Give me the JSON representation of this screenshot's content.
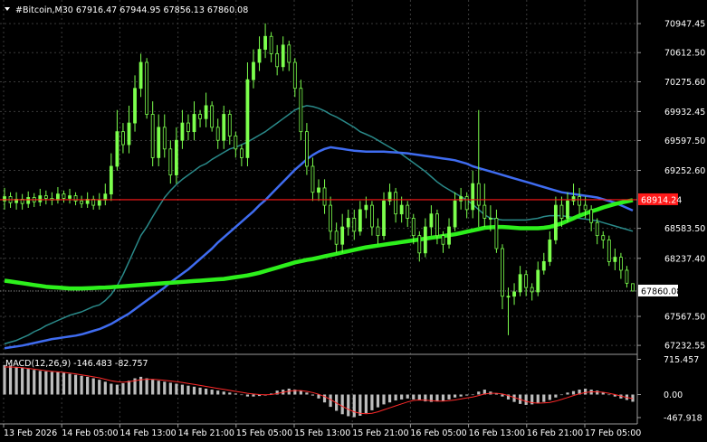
{
  "window": {
    "symbol_line": "#Bitcoin,M30  67916.47 67944.95 67856.13 67860.08"
  },
  "colors": {
    "background": "#000000",
    "grid": "#3a3a3a",
    "axis": "#9a9a9a",
    "text": "#ffffff",
    "candle": "#7cff4d",
    "ma_fast": "#2a8a8a",
    "ma_mid": "#3f6cf0",
    "ma_slow": "#2df01c",
    "hline": "#ff1a1a",
    "price_tag_bg": "#ffffff",
    "price_tag_text": "#000000",
    "hline_tag_text": "#ffffff",
    "macd_hist": "#bdbdbd",
    "macd_signal": "#ff2a2a"
  },
  "chart_data": {
    "type": "candlestick",
    "title": "#Bitcoin,M30  67916.47 67944.95 67856.13 67860.08",
    "ylim": [
      67150,
      71220
    ],
    "y_ticks": [
      "70947.45",
      "70612.50",
      "70275.60",
      "69932.45",
      "69597.50",
      "69252.60",
      "68914.24",
      "68583.50",
      "68237.40",
      "67860.08",
      "67567.50",
      "67232.55"
    ],
    "x_ticks": [
      "13 Feb 2026",
      "14 Feb 05:00",
      "14 Feb 13:00",
      "14 Feb 21:00",
      "15 Feb 05:00",
      "15 Feb 13:00",
      "15 Feb 21:00",
      "16 Feb 05:00",
      "16 Feb 13:00",
      "16 Feb 21:00",
      "17 Feb 05:00"
    ],
    "current_price": "67860.08",
    "horizontal_line": {
      "value": "68914.24"
    },
    "close": [
      68950,
      68880,
      68920,
      68870,
      68940,
      68890,
      68960,
      68930,
      68910,
      68980,
      68930,
      68960,
      68900,
      68870,
      68920,
      68850,
      68910,
      68980,
      69300,
      69700,
      69550,
      69800,
      70200,
      70500,
      69900,
      69400,
      69750,
      69500,
      69200,
      69600,
      69800,
      69700,
      69900,
      69850,
      70000,
      69750,
      69600,
      69900,
      69650,
      69500,
      69400,
      70300,
      70500,
      70650,
      70800,
      70600,
      70450,
      70700,
      70500,
      70200,
      69700,
      69300,
      69000,
      69050,
      68850,
      68550,
      68400,
      68600,
      68700,
      68550,
      68800,
      68850,
      68600,
      68500,
      68900,
      69000,
      68750,
      68850,
      68700,
      68500,
      68300,
      68600,
      68750,
      68500,
      68400,
      68600,
      68900,
      68950,
      68800,
      69100,
      68850,
      68700,
      68700,
      68350,
      67800,
      67800,
      67850,
      68050,
      67900,
      67850,
      68100,
      68200,
      68450,
      68850,
      68700,
      68900,
      68950,
      68850,
      68800,
      68650,
      68500,
      68450,
      68200,
      68250,
      68100,
      67950,
      67860
    ],
    "open": [
      68900,
      68950,
      68880,
      68920,
      68870,
      68940,
      68890,
      68960,
      68930,
      68910,
      68980,
      68930,
      68960,
      68900,
      68870,
      68920,
      68850,
      68910,
      68980,
      69300,
      69700,
      69550,
      69800,
      70200,
      70500,
      69900,
      69400,
      69750,
      69500,
      69200,
      69600,
      69800,
      69700,
      69900,
      69850,
      70000,
      69750,
      69600,
      69900,
      69650,
      69500,
      69400,
      70300,
      70500,
      70650,
      70800,
      70600,
      70450,
      70700,
      70500,
      70200,
      69700,
      69300,
      69000,
      69050,
      68850,
      68550,
      68400,
      68600,
      68700,
      68550,
      68800,
      68850,
      68600,
      68500,
      68900,
      69000,
      68750,
      68850,
      68700,
      68500,
      68300,
      68600,
      68750,
      68500,
      68400,
      68600,
      68900,
      68950,
      68800,
      69100,
      68850,
      68700,
      68700,
      68350,
      67800,
      67800,
      67850,
      68050,
      67900,
      67850,
      68100,
      68200,
      68450,
      68850,
      68700,
      68900,
      68950,
      68850,
      68800,
      68650,
      68500,
      68450,
      68200,
      68250,
      68100,
      67944.95
    ],
    "high": [
      69050,
      69000,
      69000,
      68980,
      69010,
      68990,
      69040,
      69020,
      69000,
      69060,
      69020,
      69040,
      69000,
      68960,
      69000,
      68960,
      68990,
      69100,
      69450,
      69950,
      69800,
      70000,
      70350,
      70600,
      70550,
      70050,
      69900,
      69900,
      69600,
      69750,
      69950,
      69900,
      70050,
      69950,
      70150,
      70050,
      69850,
      70000,
      69950,
      69700,
      69550,
      70500,
      70650,
      70800,
      70950,
      70850,
      70700,
      70800,
      70750,
      70550,
      70300,
      69800,
      69400,
      69150,
      69150,
      68950,
      68650,
      68750,
      68800,
      68800,
      68900,
      68950,
      68900,
      68700,
      69000,
      69100,
      69050,
      68950,
      68900,
      68750,
      68550,
      68700,
      68850,
      68800,
      68550,
      68700,
      69000,
      69050,
      69000,
      69250,
      69950,
      69100,
      68850,
      68800,
      68400,
      67900,
      67950,
      68150,
      68100,
      67950,
      68200,
      68300,
      68550,
      68950,
      68950,
      69000,
      69100,
      69050,
      68950,
      68850,
      68700,
      68550,
      68500,
      68350,
      68300,
      68150,
      67944.95
    ],
    "low": [
      68800,
      68820,
      68800,
      68800,
      68820,
      68830,
      68840,
      68860,
      68850,
      68870,
      68880,
      68870,
      68850,
      68820,
      68820,
      68800,
      68800,
      68850,
      68900,
      69250,
      69450,
      69450,
      69700,
      70100,
      69850,
      69300,
      69300,
      69400,
      69100,
      69100,
      69500,
      69600,
      69600,
      69750,
      69750,
      69700,
      69500,
      69500,
      69550,
      69400,
      69300,
      69300,
      70200,
      70400,
      70550,
      70500,
      70350,
      70400,
      70400,
      70100,
      69600,
      69200,
      68900,
      68900,
      68750,
      68450,
      68300,
      68300,
      68500,
      68450,
      68500,
      68700,
      68500,
      68400,
      68450,
      68850,
      68650,
      68650,
      68600,
      68400,
      68200,
      68250,
      68500,
      68400,
      68300,
      68350,
      68550,
      68800,
      68700,
      68700,
      68600,
      68600,
      68550,
      68300,
      67650,
      67350,
      67700,
      67800,
      67800,
      67750,
      67800,
      68050,
      68150,
      68400,
      68600,
      68650,
      68850,
      68750,
      68700,
      68550,
      68400,
      68350,
      68150,
      68100,
      68000,
      67900,
      67856.13
    ],
    "series": [
      {
        "values": [
          67250,
          67270,
          67290,
          67320,
          67350,
          67390,
          67420,
          67460,
          67490,
          67520,
          67550,
          67580,
          67600,
          67620,
          67650,
          67680,
          67700,
          67750,
          67820,
          67920,
          68050,
          68200,
          68350,
          68500,
          68600,
          68720,
          68830,
          68940,
          69020,
          69090,
          69150,
          69200,
          69250,
          69300,
          69330,
          69380,
          69420,
          69460,
          69500,
          69520,
          69550,
          69580,
          69620,
          69660,
          69700,
          69750,
          69800,
          69850,
          69900,
          69950,
          69980,
          70000,
          69990,
          69970,
          69940,
          69900,
          69870,
          69830,
          69790,
          69750,
          69700,
          69670,
          69640,
          69600,
          69560,
          69520,
          69480,
          69440,
          69390,
          69340,
          69290,
          69240,
          69180,
          69120,
          69070,
          69030,
          68990,
          68950,
          68910,
          68860,
          68800,
          68740,
          68700,
          68690,
          68680,
          68680,
          68680,
          68680,
          68680,
          68690,
          68700,
          68720,
          68730,
          68730,
          68730,
          68720,
          68710,
          68700,
          68690,
          68680,
          68670,
          68650,
          68630,
          68610,
          68590,
          68570,
          68550
        ]
      },
      {
        "values": [
          67200,
          67210,
          67220,
          67230,
          67245,
          67260,
          67275,
          67290,
          67305,
          67315,
          67325,
          67335,
          67345,
          67360,
          67380,
          67400,
          67420,
          67450,
          67480,
          67520,
          67560,
          67600,
          67650,
          67700,
          67750,
          67800,
          67850,
          67900,
          67960,
          68010,
          68060,
          68110,
          68170,
          68230,
          68290,
          68350,
          68420,
          68480,
          68540,
          68600,
          68660,
          68720,
          68780,
          68850,
          68910,
          68980,
          69050,
          69120,
          69190,
          69260,
          69320,
          69380,
          69430,
          69470,
          69500,
          69520,
          69510,
          69500,
          69490,
          69480,
          69475,
          69470,
          69470,
          69470,
          69470,
          69465,
          69460,
          69455,
          69450,
          69440,
          69430,
          69420,
          69410,
          69400,
          69390,
          69380,
          69370,
          69350,
          69330,
          69300,
          69280,
          69260,
          69240,
          69220,
          69200,
          69180,
          69160,
          69140,
          69120,
          69100,
          69080,
          69060,
          69040,
          69020,
          69000,
          68990,
          68980,
          68970,
          68960,
          68950,
          68940,
          68920,
          68900,
          68880,
          68850,
          68820,
          68790
        ]
      },
      {
        "values": [
          67980,
          67970,
          67960,
          67950,
          67940,
          67930,
          67920,
          67910,
          67905,
          67900,
          67895,
          67890,
          67890,
          67890,
          67892,
          67895,
          67898,
          67900,
          67905,
          67910,
          67915,
          67920,
          67925,
          67930,
          67935,
          67940,
          67945,
          67950,
          67955,
          67960,
          67965,
          67970,
          67975,
          67980,
          67985,
          67990,
          67995,
          68000,
          68010,
          68020,
          68030,
          68040,
          68055,
          68070,
          68090,
          68110,
          68130,
          68150,
          68170,
          68190,
          68205,
          68220,
          68230,
          68245,
          68260,
          68275,
          68290,
          68305,
          68320,
          68335,
          68350,
          68365,
          68375,
          68385,
          68395,
          68405,
          68415,
          68425,
          68435,
          68445,
          68455,
          68465,
          68475,
          68485,
          68495,
          68505,
          68515,
          68530,
          68545,
          68560,
          68575,
          68590,
          68595,
          68600,
          68600,
          68595,
          68590,
          68585,
          68585,
          68585,
          68585,
          68590,
          68600,
          68620,
          68640,
          68670,
          68700,
          68730,
          68755,
          68780,
          68800,
          68825,
          68845,
          68865,
          68880,
          68895,
          68910
        ]
      }
    ],
    "macd": {
      "label": "MACD(12,26,9) -146.483 -82.757",
      "ylim": [
        -560,
        780
      ],
      "y_ticks": [
        "715.457",
        "0.00",
        "-467.918"
      ],
      "histogram": [
        600,
        590,
        560,
        540,
        520,
        500,
        480,
        470,
        460,
        455,
        440,
        420,
        400,
        380,
        360,
        330,
        300,
        260,
        220,
        200,
        230,
        280,
        330,
        360,
        330,
        300,
        280,
        260,
        240,
        220,
        200,
        180,
        160,
        140,
        120,
        100,
        80,
        60,
        40,
        20,
        0,
        -40,
        -40,
        -30,
        -20,
        20,
        80,
        100,
        120,
        100,
        80,
        40,
        -20,
        -80,
        -160,
        -250,
        -330,
        -400,
        -440,
        -460,
        -430,
        -380,
        -320,
        -260,
        -200,
        -160,
        -120,
        -100,
        -80,
        -100,
        -120,
        -140,
        -150,
        -140,
        -130,
        -100,
        -60,
        -40,
        -20,
        0,
        60,
        100,
        60,
        20,
        -40,
        -100,
        -150,
        -190,
        -210,
        -200,
        -180,
        -150,
        -110,
        -60,
        0,
        40,
        70,
        100,
        120,
        100,
        80,
        40,
        0,
        -40,
        -80,
        -110,
        -146.483
      ],
      "signal": [
        560,
        560,
        555,
        545,
        530,
        515,
        500,
        485,
        470,
        460,
        450,
        435,
        420,
        400,
        380,
        360,
        340,
        310,
        280,
        260,
        250,
        260,
        280,
        300,
        310,
        310,
        300,
        290,
        275,
        260,
        245,
        225,
        205,
        185,
        165,
        145,
        125,
        105,
        85,
        65,
        45,
        25,
        10,
        0,
        -5,
        0,
        20,
        45,
        70,
        80,
        80,
        65,
        40,
        5,
        -40,
        -100,
        -170,
        -240,
        -300,
        -350,
        -380,
        -390,
        -380,
        -350,
        -310,
        -270,
        -230,
        -190,
        -150,
        -120,
        -110,
        -115,
        -125,
        -135,
        -135,
        -125,
        -110,
        -90,
        -70,
        -50,
        -20,
        10,
        25,
        25,
        10,
        -20,
        -60,
        -100,
        -140,
        -165,
        -175,
        -170,
        -160,
        -135,
        -100,
        -60,
        -20,
        15,
        40,
        55,
        55,
        45,
        25,
        0,
        -30,
        -60,
        -82.757
      ]
    }
  }
}
